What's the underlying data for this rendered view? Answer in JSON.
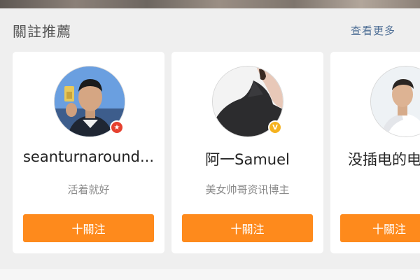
{
  "header": {
    "title": "關註推薦",
    "see_more": "查看更多"
  },
  "cards": [
    {
      "name": "seanturnaround...",
      "description": "活着就好",
      "follow_label": "十關注",
      "badge": "red-star-badge",
      "avatar_bg": "#5b8fd6"
    },
    {
      "name": "阿一Samuel",
      "description": "美女帅哥资讯博主",
      "follow_label": "十關注",
      "badge": "gold-v-badge",
      "avatar_bg": "#f4f4f4"
    },
    {
      "name": "没插电的电",
      "description": "",
      "follow_label": "十關注",
      "badge": "",
      "avatar_bg": "#e8eef2"
    }
  ],
  "colors": {
    "accent": "#fe8a1c",
    "link": "#4f6f96",
    "background": "#efefef"
  }
}
